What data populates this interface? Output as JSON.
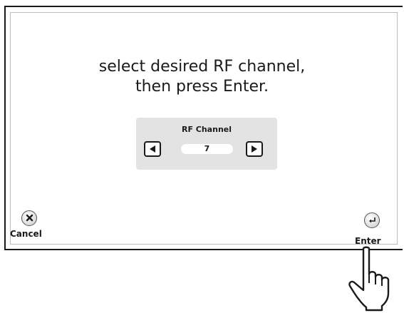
{
  "prompt": {
    "line1": "select desired RF channel,",
    "line2": "then press Enter."
  },
  "rf_panel": {
    "title": "RF Channel",
    "value": "7",
    "prev_icon": "triangle-left-icon",
    "next_icon": "triangle-right-icon"
  },
  "buttons": {
    "cancel_label": "Cancel",
    "cancel_icon": "x-icon",
    "enter_label": "Enter",
    "enter_icon": "return-arrow-icon"
  },
  "overlay": {
    "hand_icon": "pointing-hand-icon"
  },
  "colors": {
    "frame": "#1a1a1a",
    "panel_bg": "#e3e3e3",
    "text": "#1a1a1a"
  }
}
